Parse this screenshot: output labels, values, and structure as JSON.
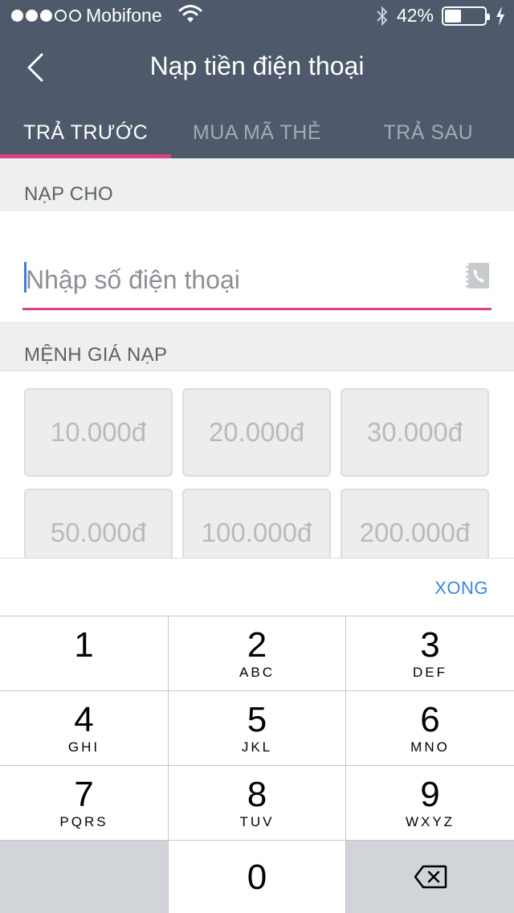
{
  "status_bar": {
    "carrier": "Mobifone",
    "signal_bars_filled": 3,
    "signal_bars_total": 5,
    "battery_percent": "42%",
    "battery_level": 0.42
  },
  "nav": {
    "title": "Nạp tiền điện thoại"
  },
  "tabs": [
    {
      "label": "TRẢ TRƯỚC",
      "active": true
    },
    {
      "label": "MUA MÃ THẺ",
      "active": false
    },
    {
      "label": "TRẢ SAU",
      "active": false
    }
  ],
  "phone_section": {
    "label": "NẠP CHO",
    "placeholder": "Nhập số điện thoại",
    "value": ""
  },
  "amount_section": {
    "label": "MỆNH GIÁ NẠP",
    "amounts": [
      "10.000đ",
      "20.000đ",
      "30.000đ",
      "50.000đ",
      "100.000đ",
      "200.000đ"
    ]
  },
  "keyboard": {
    "done_label": "XONG",
    "keys": [
      {
        "digit": "1",
        "letters": ""
      },
      {
        "digit": "2",
        "letters": "ABC"
      },
      {
        "digit": "3",
        "letters": "DEF"
      },
      {
        "digit": "4",
        "letters": "GHI"
      },
      {
        "digit": "5",
        "letters": "JKL"
      },
      {
        "digit": "6",
        "letters": "MNO"
      },
      {
        "digit": "7",
        "letters": "PQRS"
      },
      {
        "digit": "8",
        "letters": "TUV"
      },
      {
        "digit": "9",
        "letters": "WXYZ"
      },
      {
        "digit": "0",
        "letters": ""
      }
    ]
  },
  "colors": {
    "header_bg": "#4e5a6b",
    "accent_pink": "#d9418d",
    "done_blue": "#3b86d8"
  }
}
